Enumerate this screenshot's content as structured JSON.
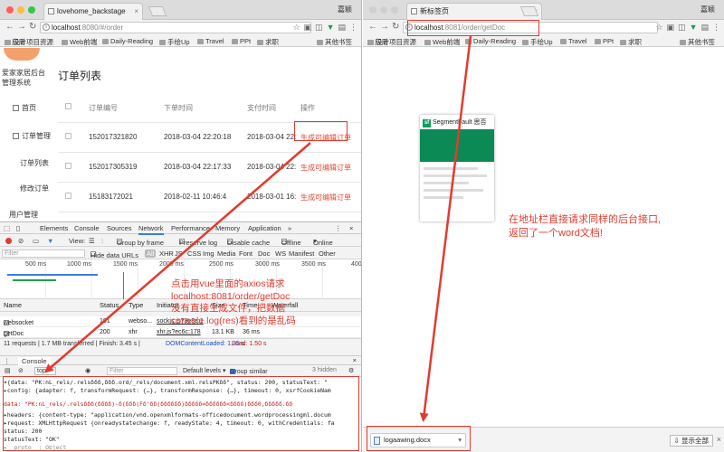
{
  "left": {
    "tab_title": "lovehome_backstage",
    "user": "嘉颖",
    "url_host": "localhost",
    "url_path": ":8080/#/order",
    "bookmarks": [
      "应用",
      "设计项目资源",
      "Web前端",
      "Daily-Reading",
      "手绘Up",
      "Travel",
      "PPt",
      "求职",
      "其他书签"
    ],
    "brand": "爱家家居后台管理系统",
    "sidebar": [
      "首页",
      "订单管理",
      "订单列表",
      "修改订单",
      "用户管理"
    ],
    "page_title": "订单列表",
    "table": {
      "headers": [
        "订单编号",
        "下单时间",
        "支付时间",
        "操作"
      ],
      "rows": [
        [
          "152017321820",
          "2018-03-04 22:20:18",
          "2018-03-04 22:",
          "生成可编辑订单"
        ],
        [
          "152017305319",
          "2018-03-04 22:17:33",
          "2018-03-04 22:",
          "生成可编辑订单"
        ],
        [
          "15183172021",
          "2018-02-11 10:46:4",
          "2018-03-01 16:",
          "生成可编辑订单"
        ]
      ]
    },
    "devtools": {
      "tabs": [
        "Elements",
        "Console",
        "Sources",
        "Network",
        "Performance",
        "Memory",
        "Application"
      ],
      "active_tab": "Network",
      "view_label": "View:",
      "group_by_frame": "Group by frame",
      "preserve_log": "Preserve log",
      "disable_cache": "Disable cache",
      "offline": "Offline",
      "online": "Online",
      "filter_placeholder": "Filter",
      "hide_data_urls": "Hide data URLs",
      "type_filters": [
        "All",
        "XHR",
        "JS",
        "CSS",
        "Img",
        "Media",
        "Font",
        "Doc",
        "WS",
        "Manifest",
        "Other"
      ],
      "timeline_ticks": [
        "500 ms",
        "1000 ms",
        "1500 ms",
        "2000 ms",
        "2500 ms",
        "3000 ms",
        "3500 ms",
        "400"
      ],
      "columns": [
        "Name",
        "Status",
        "Type",
        "Initiator",
        "Size",
        "Time",
        "Waterfall"
      ],
      "requests": [
        {
          "name": "websocket",
          "status": "101",
          "type": "webso...",
          "initiator": "sockjs.js?3e8e:1",
          "size": "",
          "time": ""
        },
        {
          "name": "getDoc",
          "status": "200",
          "type": "xhr",
          "initiator": "xhr.js?ec6c:178",
          "size": "13.1 KB",
          "time": "36 ms"
        }
      ],
      "summary": "11 requests | 1.7 MB transferred | Finish: 3.45 s | ",
      "dom_loaded": "DOMContentLoaded: 1.35 s",
      "load": "Load: 1.50 s",
      "drawer_tab": "Console",
      "context": "top",
      "console_filter": "Filter",
      "levels": "Default levels ▾",
      "group_similar": "Group similar",
      "hidden": "3 hidden",
      "console_lines": [
        "▾{data: \"PK:nL_rels/.relsδδδ,δδδ.ord/_rels/document.xml.relsPKδδ\", status: 200, statusText: \"",
        "  ▸config: {adapter: f, transformRequest: {…}, transformResponse: {…}, timeout: 0, xsrfCookieNam",
        "   data: \"PK:nL_rels/.relsδδδ(δδδδ)-δ(δδδ(Fδ'δδ(δδδδδδ)δδδδδ=δδδδδδ<δδδδ)δδδ0,δδδδδ.δδ",
        "  ▸headers: {content-type: \"application/vnd.openxmlformats-officedocument.wordprocessingml.docum",
        "  ▸request: XMLHttpRequest {onreadystatechange: f, readyState: 4, timeout: 0, withCredentials: fa",
        "   status: 200",
        "   statusText: \"OK\"",
        "  ▸__proto__: Object"
      ]
    }
  },
  "right": {
    "tab_title": "新标签页",
    "user": "嘉颖",
    "url_host": "localhost",
    "url_path": ":8081/order/getDoc",
    "bookmarks": [
      "应用",
      "设计项目资源",
      "Web前端",
      "Daily-Reading",
      "手绘Up",
      "Travel",
      "PPt",
      "求职",
      "其他书签"
    ],
    "thumbnail_title": "SegmentFault 思否",
    "download_file": "logaawing.docx",
    "show_all": "显示全部"
  },
  "annotations": {
    "left_note": [
      "点击用vue里面的axios请求",
      "localhost:8081/order/getDoc",
      "没有直接生成文件，把数据",
      "console.log(res)看到的是乱码"
    ],
    "right_note": [
      "在地址栏直接请求同样的后台接口,",
      "返回了一个word文档!"
    ]
  },
  "colors": {
    "annotation": "#e23b2e",
    "accent": "#3a7be0",
    "edit_link": "#e8452f"
  },
  "icons": [
    "back-icon",
    "forward-icon",
    "reload-icon",
    "info-icon",
    "star-icon",
    "menu-icon",
    "record-icon",
    "clear-icon",
    "filter-icon",
    "document-icon",
    "chevron-down-icon",
    "gear-icon"
  ]
}
